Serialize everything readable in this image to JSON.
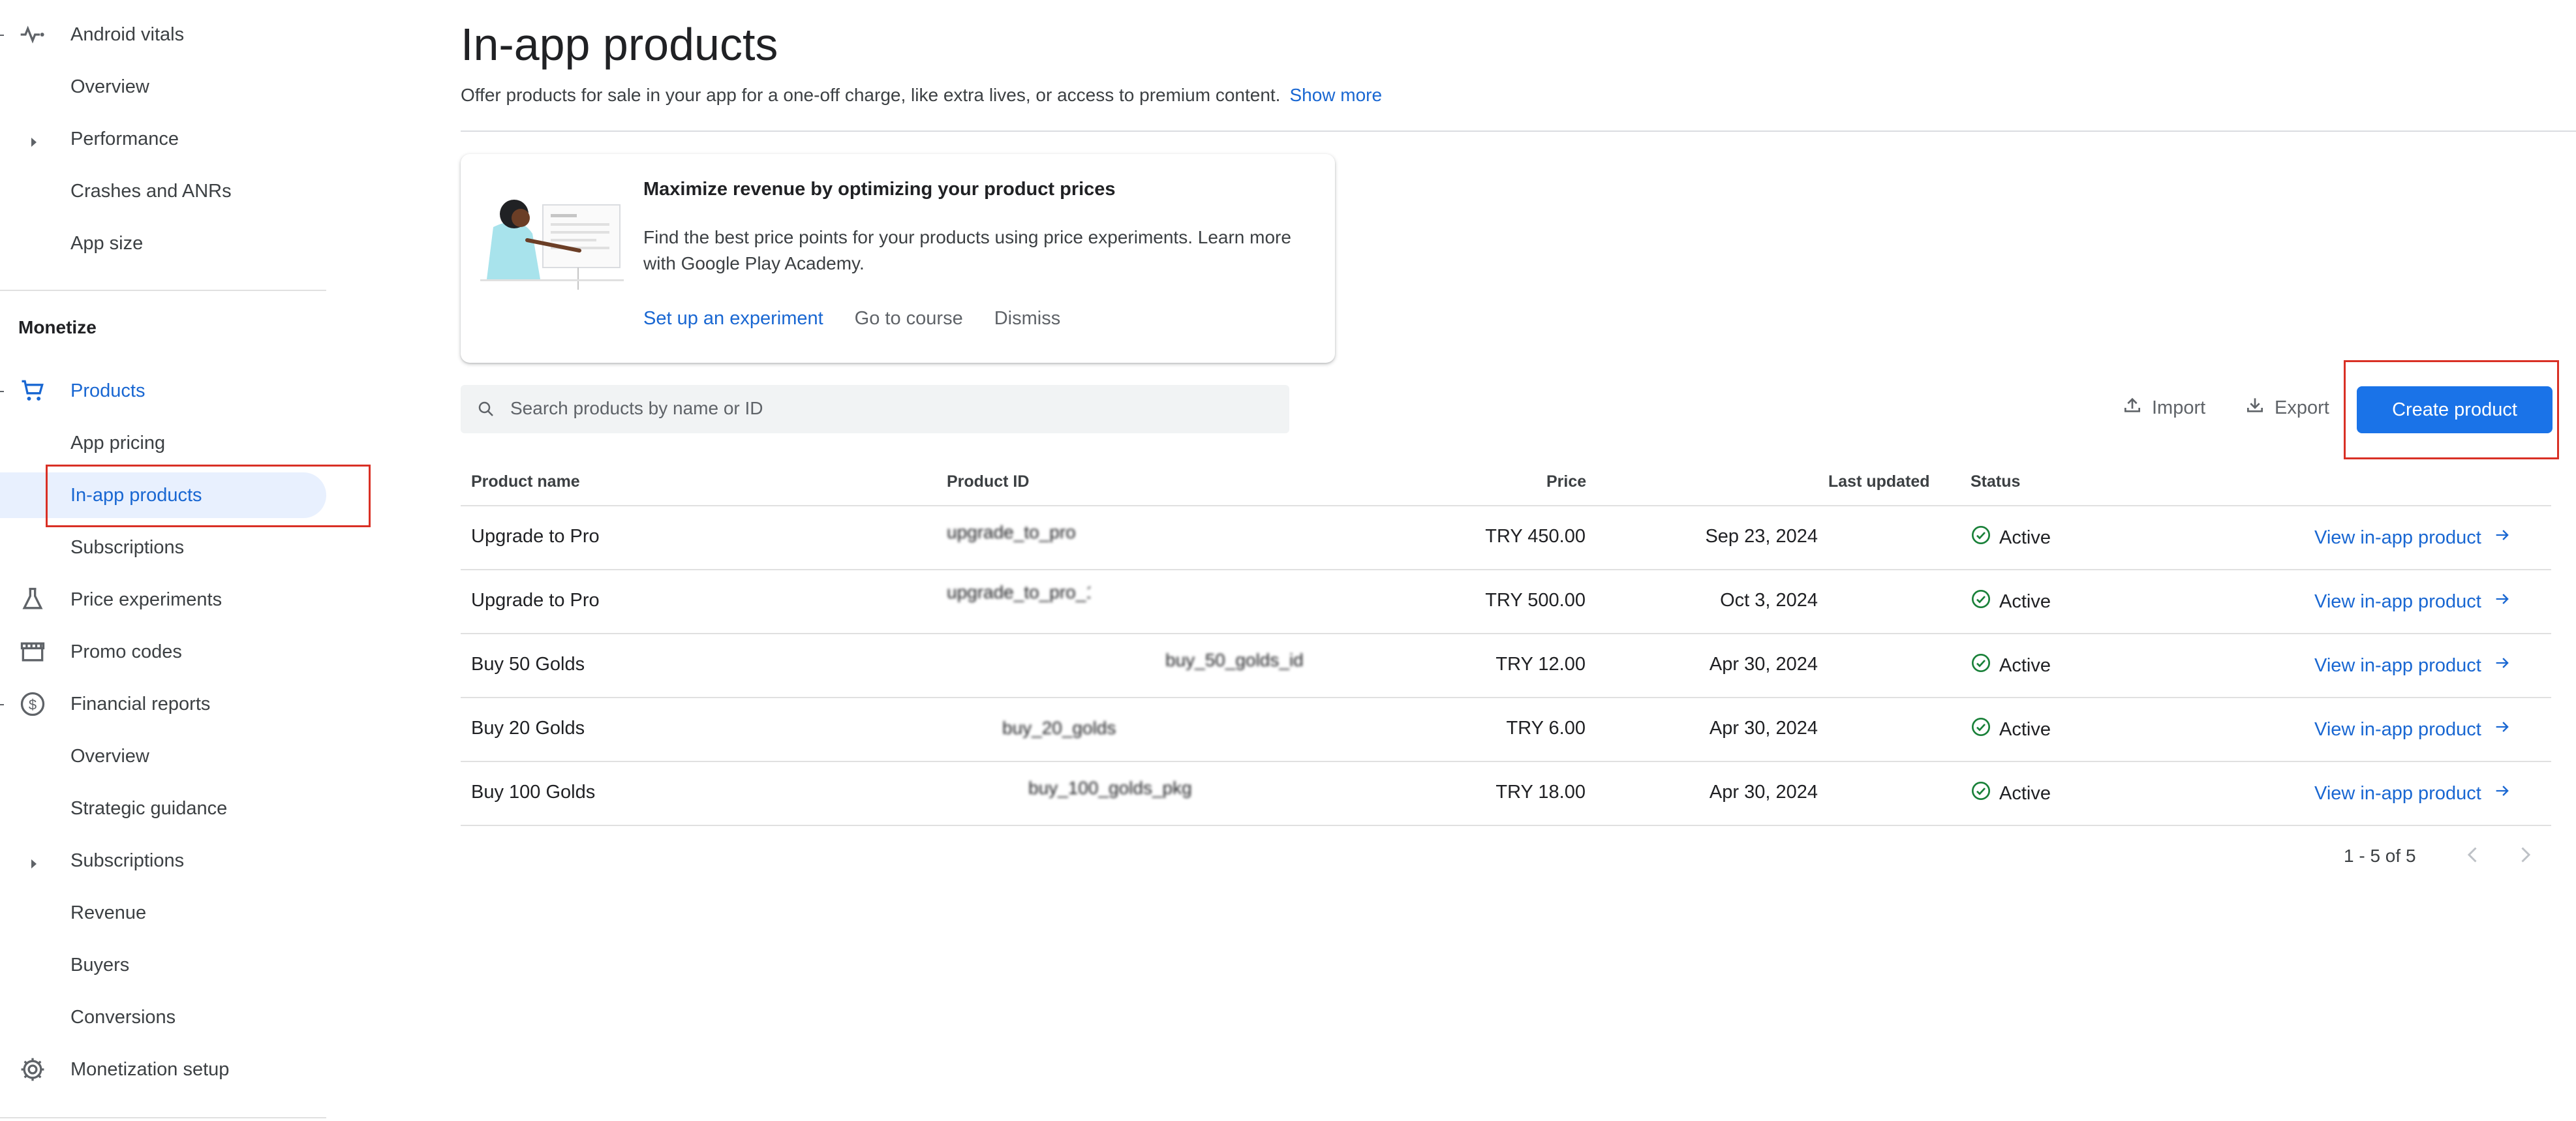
{
  "sidebar": {
    "items": [
      {
        "label": "Android vitals",
        "icon": "vitals-icon"
      },
      {
        "label": "Overview"
      },
      {
        "label": "Performance",
        "icon": "caret-right-icon"
      },
      {
        "label": "Crashes and ANRs"
      },
      {
        "label": "App size"
      }
    ],
    "monetize_title": "Monetize",
    "monetize_items": [
      {
        "label": "Products",
        "icon": "cart-icon"
      },
      {
        "label": "App pricing"
      },
      {
        "label": "In-app products"
      },
      {
        "label": "Subscriptions"
      },
      {
        "label": "Price experiments",
        "icon": "flask-icon"
      },
      {
        "label": "Promo codes",
        "icon": "store-icon"
      },
      {
        "label": "Financial reports",
        "icon": "dollar-icon"
      },
      {
        "label": "Overview"
      },
      {
        "label": "Strategic guidance"
      },
      {
        "label": "Subscriptions",
        "icon": "caret-right-icon"
      },
      {
        "label": "Revenue"
      },
      {
        "label": "Buyers"
      },
      {
        "label": "Conversions"
      },
      {
        "label": "Monetization setup",
        "icon": "gear-icon"
      }
    ]
  },
  "page": {
    "title": "In-app products",
    "subtitle": "Offer products for sale in your app for a one-off charge, like extra lives, or access to premium content.",
    "show_more": "Show more"
  },
  "promo_card": {
    "title": "Maximize revenue by optimizing your product prices",
    "body": "Find the best price points for your products using price experiments. Learn more with Google Play Academy.",
    "action_primary": "Set up an experiment",
    "action_course": "Go to course",
    "action_dismiss": "Dismiss"
  },
  "toolbar": {
    "search_placeholder": "Search products by name or ID",
    "import_label": "Import",
    "export_label": "Export",
    "create_label": "Create product"
  },
  "table": {
    "headers": {
      "name": "Product name",
      "id": "Product ID",
      "price": "Price",
      "updated": "Last updated",
      "status": "Status"
    },
    "rows": [
      {
        "name": "Upgrade to Pro",
        "id": "upgrade_to_pro",
        "price": "TRY 450.00",
        "updated": "Sep 23, 2024",
        "status": "Active",
        "link": "View in-app product"
      },
      {
        "name": "Upgrade to Pro",
        "id": "upgrade_to_pro_1",
        "price": "TRY 500.00",
        "updated": "Oct 3, 2024",
        "status": "Active",
        "link": "View in-app product"
      },
      {
        "name": "Buy 50 Golds",
        "id": "buy_50_golds_id",
        "price": "TRY 12.00",
        "updated": "Apr 30, 2024",
        "status": "Active",
        "link": "View in-app product"
      },
      {
        "name": "Buy 20 Golds",
        "id": "buy_20_golds",
        "price": "TRY 6.00",
        "updated": "Apr 30, 2024",
        "status": "Active",
        "link": "View in-app product"
      },
      {
        "name": "Buy 100 Golds",
        "id": "buy_100_golds_pkg",
        "price": "TRY 18.00",
        "updated": "Apr 30, 2024",
        "status": "Active",
        "link": "View in-app product"
      }
    ]
  },
  "pagination": {
    "range": "1 - 5 of 5"
  },
  "colors": {
    "accent": "#1a73e8",
    "link": "#1967d2",
    "active_green": "#188038",
    "highlight_box": "#d93025",
    "selected_bg": "#e8f0fe"
  }
}
